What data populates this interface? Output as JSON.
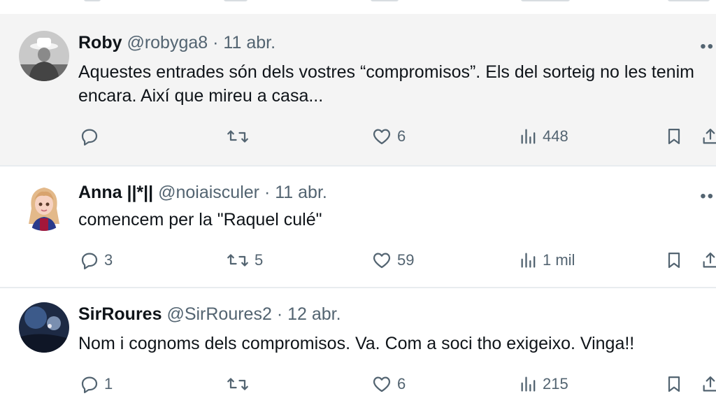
{
  "tweets": [
    {
      "name": "Roby",
      "handle": "@robyga8",
      "separator": "·",
      "date": "11 abr.",
      "text": "Aquestes entrades són dels vostres “compromisos”. Els del sorteig no les tenim encara. Així que mireu a casa...",
      "replies": "",
      "retweets": "",
      "likes": "6",
      "views": "448",
      "avatar_icon": "hat-figure-avatar",
      "highlighted": true
    },
    {
      "name": "Anna ||*||",
      "handle": "@noiaisculer",
      "separator": "·",
      "date": "11 abr.",
      "text": "comencem per la \"Raquel culé\"",
      "replies": "3",
      "retweets": "5",
      "likes": "59",
      "views": "1 mil",
      "avatar_icon": "cartoon-girl-avatar",
      "highlighted": false
    },
    {
      "name": "SirRoures",
      "handle": "@SirRoures2",
      "separator": "·",
      "date": "12 abr.",
      "text": "Nom i cognoms dels compromisos. Va.  Com a soci tho exigeixo.  Vinga!!",
      "replies": "1",
      "retweets": "",
      "likes": "6",
      "views": "215",
      "avatar_icon": "night-photo-avatar",
      "highlighted": false
    }
  ],
  "colors": {
    "text": "#0f1419",
    "muted": "#536471",
    "highlight_bg": "#f4f4f4",
    "divider": "#e8ecef"
  },
  "icons": [
    "reply-icon",
    "retweet-icon",
    "like-icon",
    "views-icon",
    "bookmark-icon",
    "share-icon",
    "more-icon"
  ]
}
